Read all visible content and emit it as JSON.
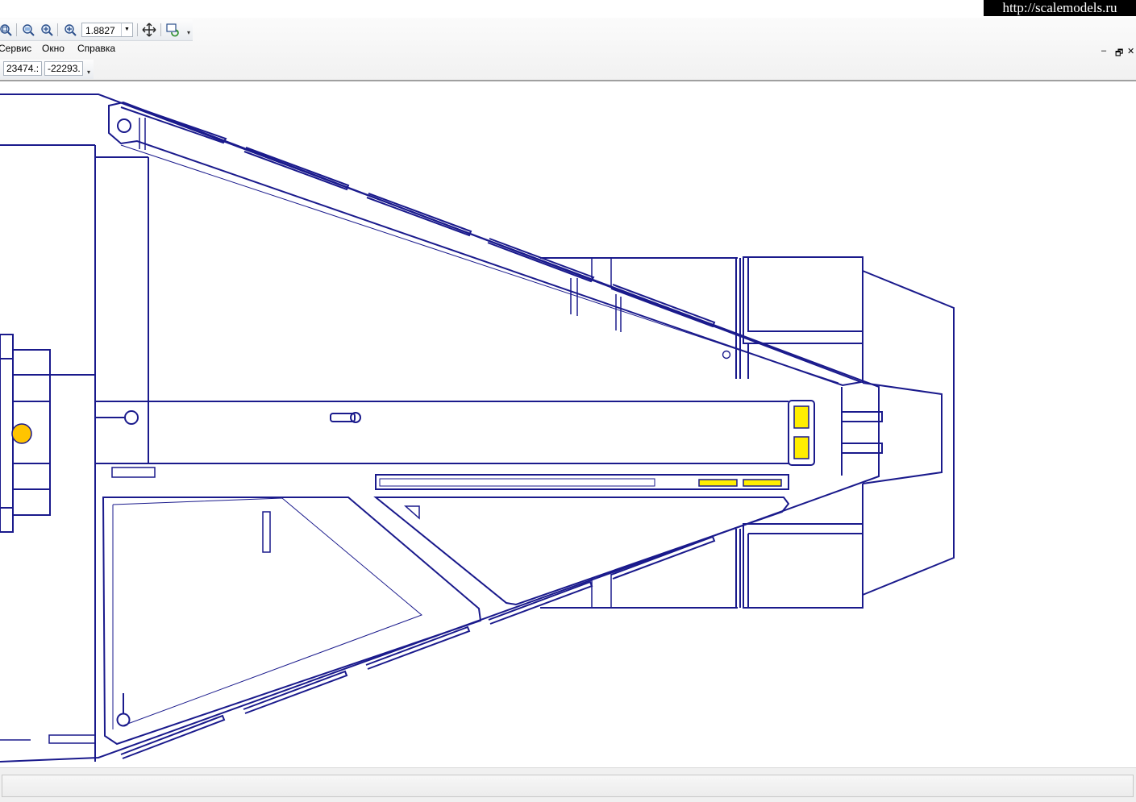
{
  "watermark": "http://scalemodels.ru",
  "toolbar": {
    "zoom_value": "1.8827",
    "icons": [
      "zoom-fit-icon",
      "zoom-window-icon",
      "zoom-previous-icon",
      "zoom-in-icon",
      "pan-icon",
      "refresh-icon"
    ]
  },
  "menu": {
    "items": [
      {
        "label": "Сервис"
      },
      {
        "label": "Окно"
      },
      {
        "label": "Справка"
      }
    ]
  },
  "coordinates": {
    "x": "23474.:",
    "y": "-22293."
  },
  "window_controls": {
    "minimize": "–",
    "restore": "🗗",
    "close": "✕"
  },
  "colors": {
    "drawing_line": "#1a1a8c",
    "highlight_yellow": "#ffee00",
    "highlight_orange": "#ffc400"
  }
}
